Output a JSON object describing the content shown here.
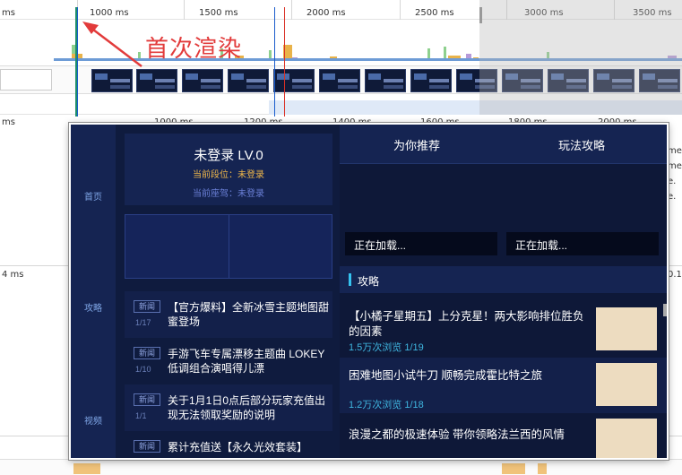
{
  "devtools": {
    "ruler_labels": [
      "1000 ms",
      "1500 ms",
      "2000 ms",
      "2500 ms",
      "3000 ms",
      "3500 ms"
    ],
    "lower_ruler_labels": [
      "1000 ms",
      "1200 ms",
      "1400 ms",
      "1600 ms",
      "1800 ms",
      "2000 ms"
    ],
    "left_labels": [
      "ms",
      "ms",
      "4 ms"
    ],
    "side_snippets": [
      "me.",
      "me.",
      "e.",
      "e.",
      "0.1"
    ],
    "annotation": "首次渲染"
  },
  "preview": {
    "nav": [
      "首页",
      "攻略",
      "视频"
    ],
    "user": {
      "name": "未登录 LV.0",
      "rank": "当前段位：未登录",
      "car": "当前座驾：未登录"
    },
    "news": [
      {
        "tag": "新闻",
        "page": "1/17",
        "title": "【官方爆料】全新冰雪主题地图甜蜜登场"
      },
      {
        "tag": "新闻",
        "page": "1/10",
        "title": "手游飞车专属漂移主题曲 LOKEY低调组合演唱得儿漂"
      },
      {
        "tag": "新闻",
        "page": "1/1",
        "title": "关于1月1日0点后部分玩家充值出现无法领取奖励的说明"
      },
      {
        "tag": "新闻",
        "page": "",
        "title": "累计充值送【永久光效套装】"
      }
    ],
    "tabs": [
      "为你推荐",
      "玩法攻略"
    ],
    "loading": [
      "正在加载...",
      "正在加载..."
    ],
    "section_title": "攻略",
    "articles": [
      {
        "title": "【小橘子星期五】上分克星！两大影响排位胜负的因素",
        "meta": "1.5万次浏览   1/19"
      },
      {
        "title": "困难地图小试牛刀 顺畅完成霍比特之旅",
        "meta": "1.2万次浏览   1/18"
      },
      {
        "title": "浪漫之都的极速体验 带你领略法兰西的风情",
        "meta": ""
      }
    ]
  },
  "colors": {
    "preview_bg": "#0e1838",
    "nav_bg": "#152452",
    "accent_cyan": "#3fb6e0",
    "rank_gold": "#f0b84a",
    "annotation_red": "#e23b3b"
  }
}
